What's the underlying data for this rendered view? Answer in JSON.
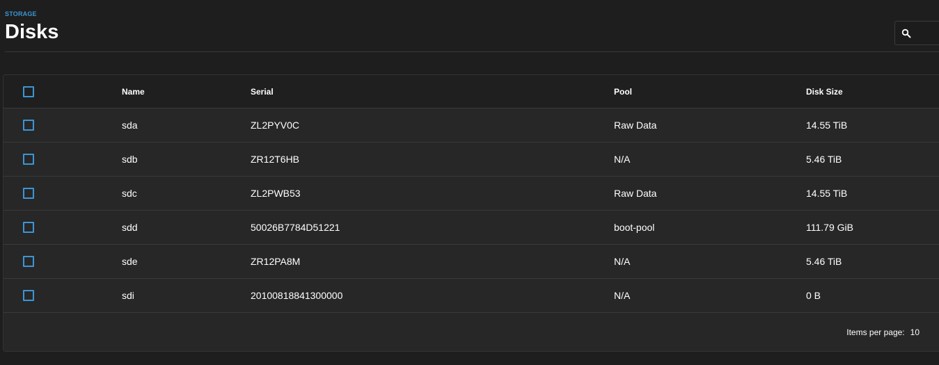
{
  "header": {
    "breadcrumb": "STORAGE",
    "title": "Disks",
    "search_icon": "search-icon"
  },
  "colors": {
    "accent": "#3b96d6",
    "background": "#1e1e1e",
    "card": "#272727",
    "header_row": "#1f1f1f",
    "divider": "#3a3a3a"
  },
  "table": {
    "columns": {
      "name": "Name",
      "serial": "Serial",
      "pool": "Pool",
      "size": "Disk Size"
    },
    "rows": [
      {
        "name": "sda",
        "serial": "ZL2PYV0C",
        "pool": "Raw Data",
        "size": "14.55 TiB"
      },
      {
        "name": "sdb",
        "serial": "ZR12T6HB",
        "pool": "N/A",
        "size": "5.46 TiB"
      },
      {
        "name": "sdc",
        "serial": "ZL2PWB53",
        "pool": "Raw Data",
        "size": "14.55 TiB"
      },
      {
        "name": "sdd",
        "serial": "50026B7784D51221",
        "pool": "boot-pool",
        "size": "111.79 GiB"
      },
      {
        "name": "sde",
        "serial": "ZR12PA8M",
        "pool": "N/A",
        "size": "5.46 TiB"
      },
      {
        "name": "sdi",
        "serial": "20100818841300000",
        "pool": "N/A",
        "size": "0 B"
      }
    ]
  },
  "pagination": {
    "items_per_page_label": "Items per page:",
    "items_per_page_value": "10"
  }
}
